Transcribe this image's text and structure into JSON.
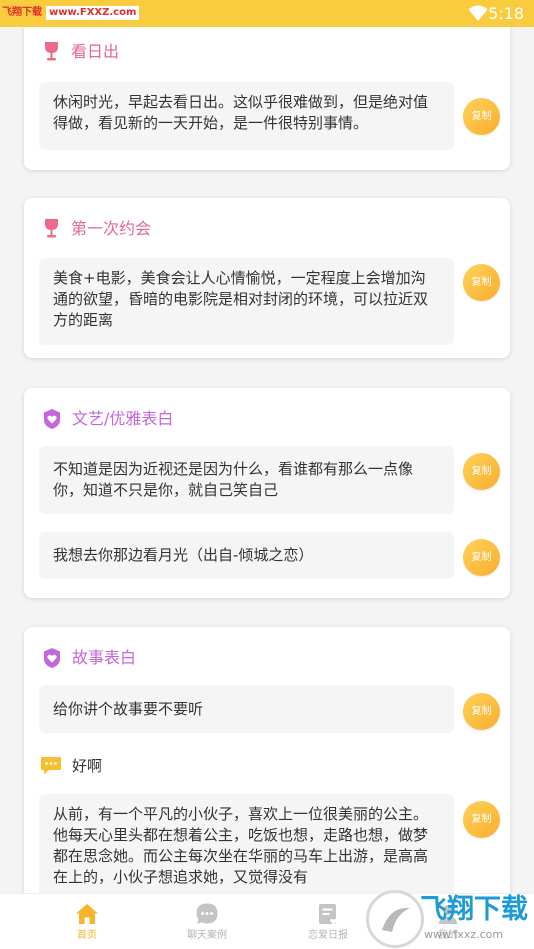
{
  "status_bar": {
    "watermark_red": "飞翔下载",
    "watermark_url": "www.FXXZ.com",
    "time": "5:18"
  },
  "cards": [
    {
      "title": "看日出",
      "icon": "wine-glass-icon",
      "items": [
        {
          "text": "休闲时光，早起去看日出。这似乎很难做到，但是绝对值得做，看见新的一天开始，是一件很特别事情。",
          "copy": "复制"
        }
      ]
    },
    {
      "title": "第一次约会",
      "icon": "wine-glass-icon",
      "items": [
        {
          "text": "美食+电影，美食会让人心情愉悦，一定程度上会增加沟通的欲望，昏暗的电影院是相对封闭的环境，可以拉近双方的距离",
          "copy": "复制"
        }
      ]
    },
    {
      "title": "文艺/优雅表白",
      "icon": "heart-badge-icon",
      "items": [
        {
          "text": "不知道是因为近视还是因为什么，看谁都有那么一点像你，知道不只是你，就自己笑自己",
          "copy": "复制"
        },
        {
          "text": "我想去你那边看月光（出自-倾城之恋）",
          "copy": "复制"
        }
      ]
    },
    {
      "title": "故事表白",
      "icon": "heart-badge-icon",
      "items": [
        {
          "text": "给你讲个故事要不要听",
          "copy": "复制"
        },
        {
          "reply": "好啊"
        },
        {
          "text": "从前，有一个平凡的小伙子，喜欢上一位很美丽的公主。他每天心里头都在想着公主，吃饭也想，走路也想，做梦都在思念她。而公主每次坐在华丽的马车上出游，是高高在上的，小伙子想追求她，又觉得没有",
          "copy": "复制"
        }
      ]
    }
  ],
  "tabs": [
    {
      "label": "首页",
      "icon": "home-icon",
      "active": true
    },
    {
      "label": "聊天案例",
      "icon": "chat-icon",
      "active": false
    },
    {
      "label": "恋爱日报",
      "icon": "daily-report-icon",
      "active": false
    },
    {
      "label": "我的",
      "icon": "profile-icon",
      "active": false
    }
  ],
  "logo_watermark": {
    "name": "飞翔下载",
    "url": "www.fxxz.com"
  },
  "colors": {
    "status_bar": "#f9cc3f",
    "accent": "#f5b42a",
    "title_pink": "#e8678d",
    "title_purple": "#c466dc"
  }
}
